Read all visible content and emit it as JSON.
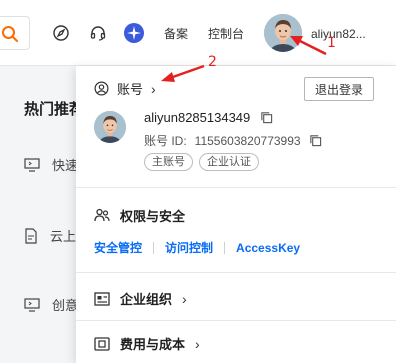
{
  "topbar": {
    "search_icon": "search-icon",
    "icons": [
      "compass-icon",
      "headset-icon",
      "sparkle-icon"
    ],
    "link_1": "备案",
    "link_2": "控制台",
    "username": "aliyun82...",
    "accent_color": "#ff6a00"
  },
  "sidebar": {
    "heading": "热门推荐",
    "items": [
      {
        "label": "快速",
        "icon": "monitor-icon"
      },
      {
        "label": "云上",
        "icon": "document-icon"
      },
      {
        "label": "创意",
        "icon": "monitor-icon"
      }
    ]
  },
  "dropdown": {
    "account_label": "账号",
    "logout_label": "退出登录",
    "account_name": "aliyun8285134349",
    "account_id_label": "账号 ID:",
    "account_id_value": "1155603820773993",
    "tags": [
      "主账号",
      "企业认证"
    ],
    "permissions_title": "权限与安全",
    "links": [
      "安全管控",
      "访问控制",
      "AccessKey"
    ],
    "link_color": "#0a6cf5",
    "org_title": "企业组织",
    "cost_title": "费用与成本"
  },
  "annotations": {
    "num_1": "1",
    "num_2": "2",
    "color": "#e52020"
  }
}
